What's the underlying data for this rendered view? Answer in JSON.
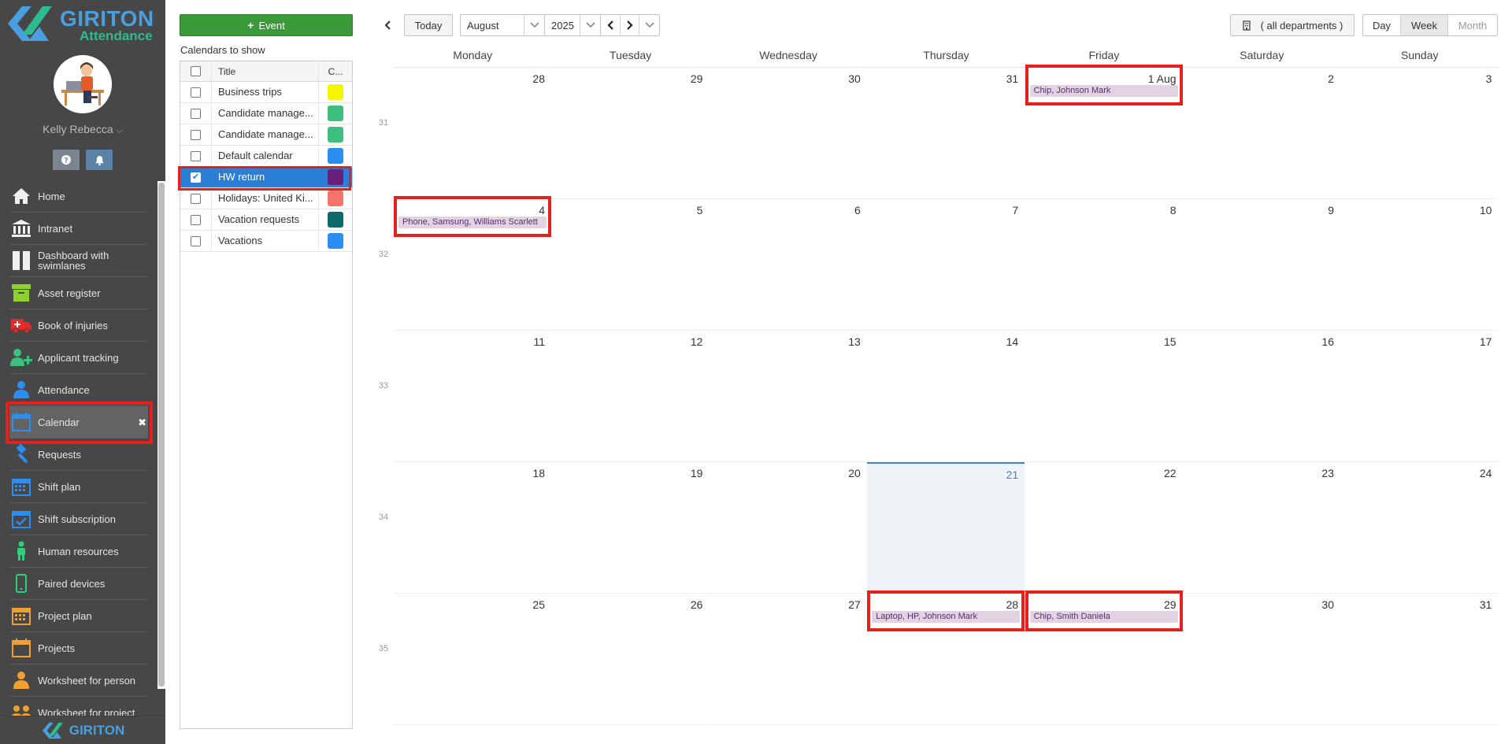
{
  "sidebar": {
    "brand": "GIRITON",
    "brand_sub": "Attendance",
    "user_name": "Kelly Rebecca",
    "footer_brand": "GIRITON",
    "items": [
      {
        "label": "Home",
        "icon": "home-icon"
      },
      {
        "label": "Intranet",
        "icon": "bank-icon"
      },
      {
        "label": "Dashboard with swimlanes",
        "icon": "swimlanes-icon"
      },
      {
        "label": "Asset register",
        "icon": "box-icon"
      },
      {
        "label": "Book of injuries",
        "icon": "ambulance-icon"
      },
      {
        "label": "Applicant tracking",
        "icon": "user-plus-icon"
      },
      {
        "label": "Attendance",
        "icon": "person-icon"
      },
      {
        "label": "Calendar",
        "icon": "calendar-icon"
      },
      {
        "label": "Requests",
        "icon": "gavel-icon"
      },
      {
        "label": "Shift plan",
        "icon": "calendar-grid-icon"
      },
      {
        "label": "Shift subscription",
        "icon": "calendar-check-icon"
      },
      {
        "label": "Human resources",
        "icon": "human-icon"
      },
      {
        "label": "Paired devices",
        "icon": "phone-icon"
      },
      {
        "label": "Project plan",
        "icon": "calendar-grid-icon"
      },
      {
        "label": "Projects",
        "icon": "calendar-icon"
      },
      {
        "label": "Worksheet for person",
        "icon": "person-icon"
      },
      {
        "label": "Worksheet for project",
        "icon": "people-icon"
      }
    ]
  },
  "calendars": {
    "add_event_label": "Event",
    "panel_title": "Calendars to show",
    "header": {
      "title": "Title",
      "color": "C..."
    },
    "rows": [
      {
        "title": "Business trips",
        "color": "#f5f500",
        "checked": false
      },
      {
        "title": "Candidate manage...",
        "color": "#3fbf7f",
        "checked": false
      },
      {
        "title": "Candidate manage...",
        "color": "#3fbf7f",
        "checked": false
      },
      {
        "title": "Default calendar",
        "color": "#2b8ff2",
        "checked": false
      },
      {
        "title": "HW return",
        "color": "#6a1f7a",
        "checked": true
      },
      {
        "title": "Holidays: United Ki...",
        "color": "#f4736a",
        "checked": false
      },
      {
        "title": "Vacation requests",
        "color": "#0f6b6b",
        "checked": false
      },
      {
        "title": "Vacations",
        "color": "#2b8ff2",
        "checked": false
      }
    ]
  },
  "toolbar": {
    "today": "Today",
    "month": "August",
    "year": "2025",
    "department": "( all departments )",
    "views": [
      "Day",
      "Week",
      "Month"
    ],
    "active_view": "Week"
  },
  "calendar": {
    "weekdays": [
      "Monday",
      "Tuesday",
      "Wednesday",
      "Thursday",
      "Friday",
      "Saturday",
      "Sunday"
    ],
    "weeks": [
      {
        "num": "31",
        "days": [
          "28",
          "29",
          "30",
          "31",
          "1 Aug",
          "2",
          "3"
        ]
      },
      {
        "num": "32",
        "days": [
          "4",
          "5",
          "6",
          "7",
          "8",
          "9",
          "10"
        ]
      },
      {
        "num": "33",
        "days": [
          "11",
          "12",
          "13",
          "14",
          "15",
          "16",
          "17"
        ]
      },
      {
        "num": "34",
        "days": [
          "18",
          "19",
          "20",
          "21",
          "22",
          "23",
          "24"
        ]
      },
      {
        "num": "35",
        "days": [
          "25",
          "26",
          "27",
          "28",
          "29",
          "30",
          "31"
        ]
      }
    ],
    "today": {
      "week": 3,
      "day": 3
    },
    "events": [
      {
        "week": 0,
        "day": 4,
        "label": "Chip, Johnson Mark"
      },
      {
        "week": 1,
        "day": 0,
        "label": "Phone, Samsung, Williams Scarlett"
      },
      {
        "week": 4,
        "day": 3,
        "label": "Laptop, HP, Johnson Mark"
      },
      {
        "week": 4,
        "day": 4,
        "label": "Chip, Smith Daniela"
      }
    ]
  }
}
